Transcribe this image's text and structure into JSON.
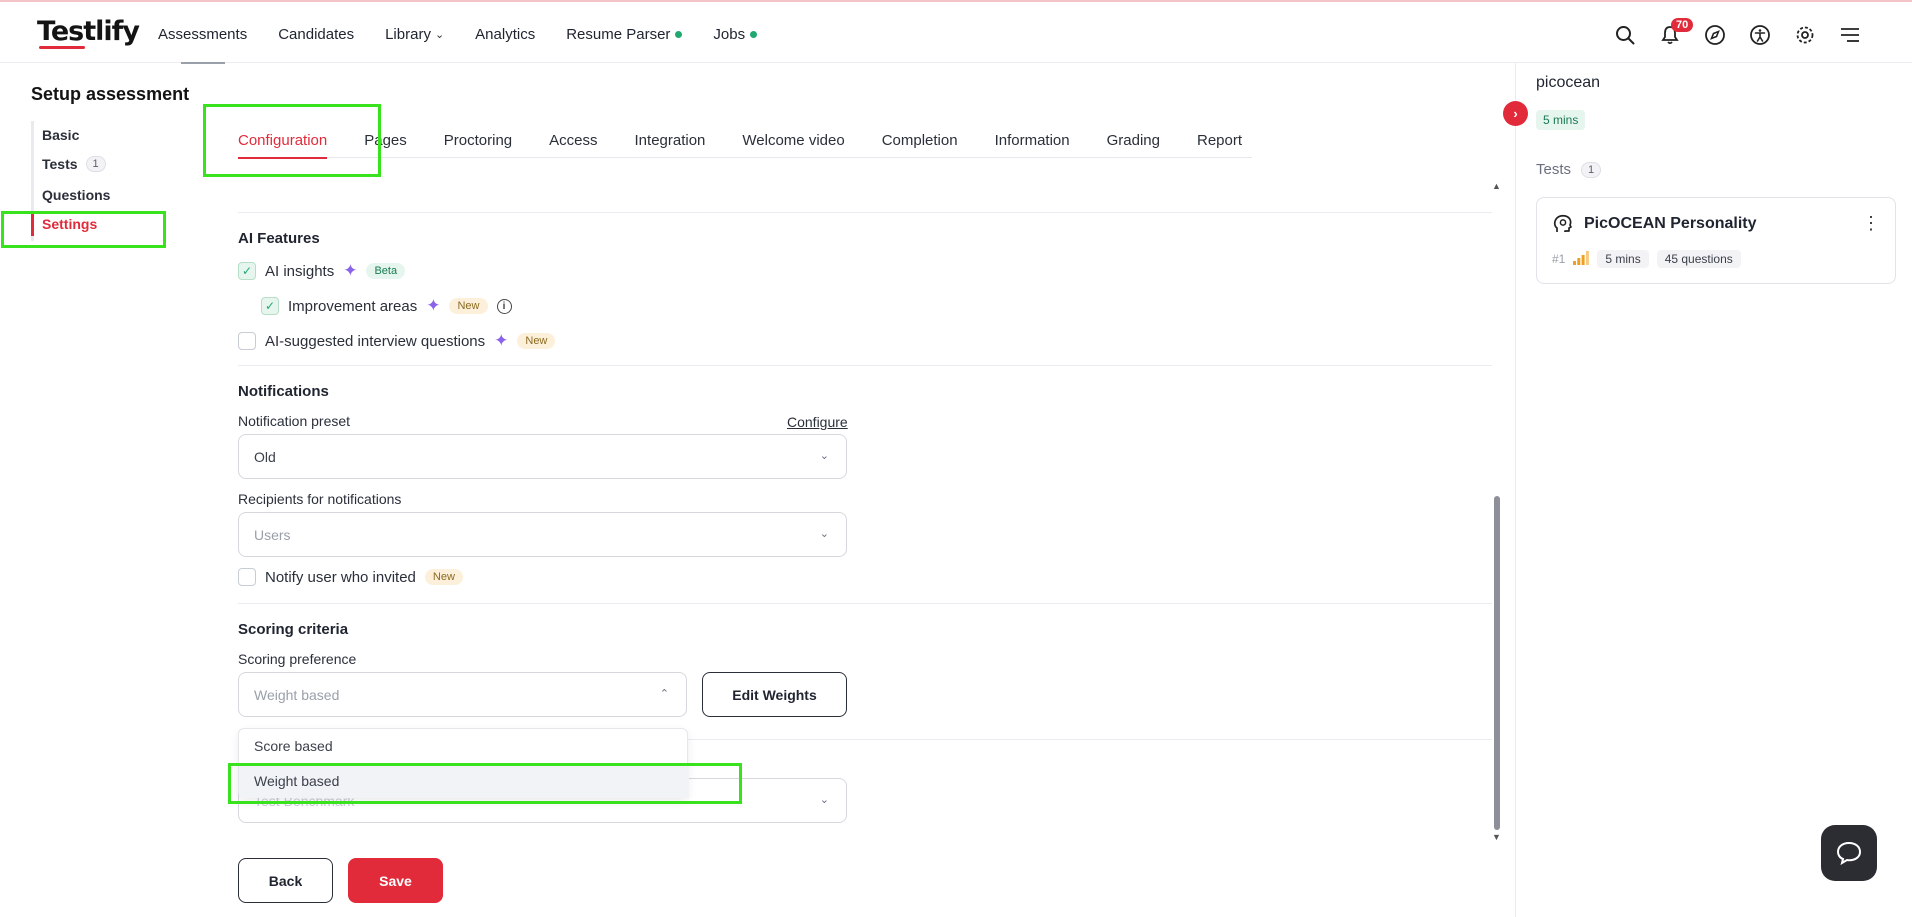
{
  "app": {
    "logo": "Testlify"
  },
  "nav": {
    "items": [
      {
        "label": "Assessments"
      },
      {
        "label": "Candidates"
      },
      {
        "label": "Library"
      },
      {
        "label": "Analytics"
      },
      {
        "label": "Resume Parser"
      },
      {
        "label": "Jobs"
      }
    ],
    "notification_count": "70"
  },
  "sidebar": {
    "title": "Setup assessment",
    "items": [
      {
        "label": "Basic"
      },
      {
        "label": "Tests",
        "count": "1"
      },
      {
        "label": "Questions"
      },
      {
        "label": "Settings"
      }
    ]
  },
  "tabs": [
    {
      "label": "Configuration"
    },
    {
      "label": "Pages"
    },
    {
      "label": "Proctoring"
    },
    {
      "label": "Access"
    },
    {
      "label": "Integration"
    },
    {
      "label": "Welcome video"
    },
    {
      "label": "Completion"
    },
    {
      "label": "Information"
    },
    {
      "label": "Grading"
    },
    {
      "label": "Report"
    }
  ],
  "ai_features": {
    "title": "AI Features",
    "ai_insights": {
      "label": "AI insights",
      "tag": "Beta",
      "checked": true
    },
    "improvement_areas": {
      "label": "Improvement areas",
      "tag": "New",
      "checked": true
    },
    "ai_questions": {
      "label": "AI-suggested interview questions",
      "tag": "New",
      "checked": false
    }
  },
  "notifications": {
    "title": "Notifications",
    "preset_label": "Notification preset",
    "configure_link": "Configure",
    "preset_value": "Old",
    "recipients_label": "Recipients for notifications",
    "recipients_placeholder": "Users",
    "notify_inviter": {
      "label": "Notify user who invited",
      "tag": "New",
      "checked": false
    }
  },
  "scoring": {
    "title": "Scoring criteria",
    "preference_label": "Scoring preference",
    "preference_value": "Weight based",
    "edit_weights": "Edit Weights",
    "options": [
      "Score based",
      "Weight based"
    ],
    "hidden_placeholder": "Test Benchmark"
  },
  "actions": {
    "back": "Back",
    "save": "Save"
  },
  "right_panel": {
    "title": "picocean",
    "duration": "5 mins",
    "tests_label": "Tests",
    "tests_count": "1",
    "test_card": {
      "name": "PicOCEAN Personality",
      "number": "#1",
      "duration": "5 mins",
      "questions": "45 questions"
    }
  },
  "colors": {
    "accent": "#e12b3a",
    "highlight": "#38e21c",
    "success": "#1fa870"
  }
}
